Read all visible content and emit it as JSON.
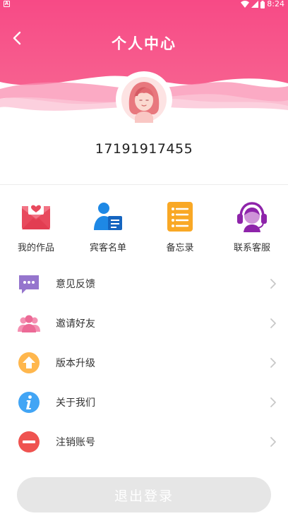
{
  "status_bar": {
    "notification_glyph": "A",
    "time": "8:24"
  },
  "header": {
    "title": "个人中心",
    "accent": "#f74b8a"
  },
  "profile": {
    "phone": "17191917455"
  },
  "grid": [
    {
      "label": "我的作品",
      "icon": "envelope-heart-icon"
    },
    {
      "label": "宾客名单",
      "icon": "guest-list-icon"
    },
    {
      "label": "备忘录",
      "icon": "memo-list-icon"
    },
    {
      "label": "联系客服",
      "icon": "customer-service-icon"
    }
  ],
  "menu": [
    {
      "label": "意见反馈",
      "icon": "feedback-icon"
    },
    {
      "label": "邀请好友",
      "icon": "invite-friends-icon"
    },
    {
      "label": "版本升级",
      "icon": "upgrade-icon"
    },
    {
      "label": "关于我们",
      "icon": "info-icon"
    },
    {
      "label": "注销账号",
      "icon": "cancel-account-icon"
    }
  ],
  "logout_label": "退出登录"
}
